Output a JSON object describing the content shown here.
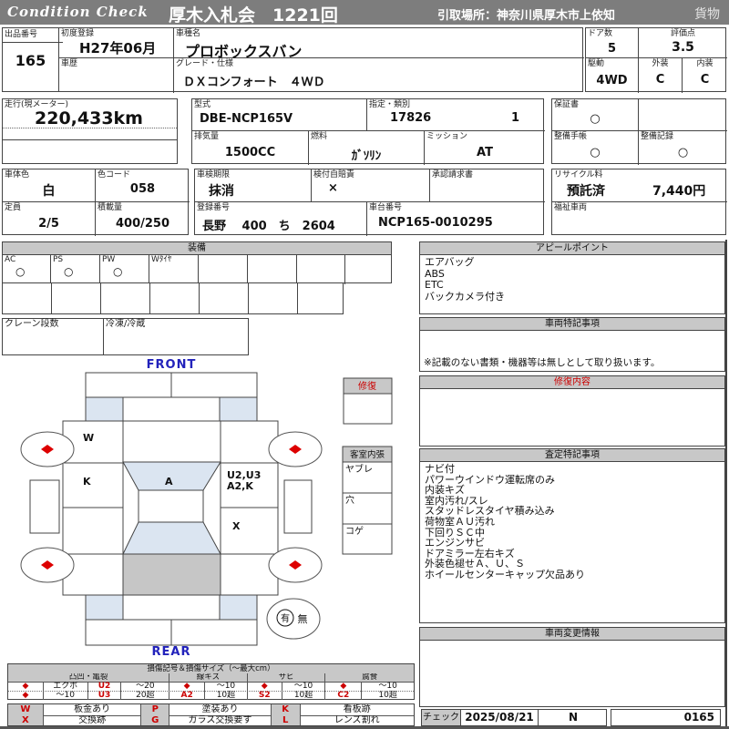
{
  "header": {
    "brand": "Condition  Check",
    "auction": "厚木入札会　1221回",
    "pickup": "引取場所：神奈川県厚木市上依知",
    "category": "貨物"
  },
  "info": {
    "exhibit_no_label": "出品番号",
    "exhibit_no": "165",
    "first_reg_label": "初度登録",
    "first_reg": "H27年06月",
    "history_label": "車歴",
    "history": "",
    "model_name_label": "車種名",
    "model_name": "プロボックスバン",
    "grade_label": "グレード・仕様",
    "grade": "ＤＸコンフォート　４ＷＤ",
    "doors_label": "ドア数",
    "doors": "5",
    "score_label": "評価点",
    "score": "3.5",
    "drive_label": "駆動",
    "drive": "4WD",
    "exterior_label": "外装",
    "exterior": "C",
    "interior_label": "内装",
    "interior": "C",
    "mileage_label": "走行(現メーター)",
    "mileage": "220,433km",
    "model_code_label": "型式",
    "model_code": "DBE-NCP165V",
    "class_label": "指定・類別",
    "class_no": "17826",
    "class_no2": "1",
    "warranty_label": "保証書",
    "warranty": "○",
    "displacement_label": "排気量",
    "displacement": "1500CC",
    "fuel_label": "燃料",
    "fuel": "ｶﾞｿﾘﾝ",
    "mission_label": "ミッション",
    "mission": "AT",
    "maintenance_book_label": "整備手帳",
    "maintenance_book": "○",
    "maintenance_record_label": "整備記録",
    "maintenance_record": "○",
    "body_color_label": "車体色",
    "body_color": "白",
    "color_code_label": "色コード",
    "color_code": "058",
    "inspection_label": "車検期限",
    "inspection": "抹消",
    "insurance_label": "検付自賠責",
    "insurance": "×",
    "approval_label": "承認請求書",
    "approval": "",
    "recycle_label": "リサイクル料",
    "recycle_status": "預託済",
    "recycle_fee": "7,440円",
    "capacity_label": "定員",
    "capacity": "2/5",
    "load_label": "積載量",
    "load": "400/250",
    "reg_no_label": "登録番号",
    "reg_no": "長野　 400　ち　2604",
    "chassis_label": "車台番号",
    "chassis_no": "NCP165-0010295",
    "welfare_label": "福祉車両",
    "welfare": ""
  },
  "equipment": {
    "title": "装備",
    "items": [
      {
        "label": "AC",
        "value": "○"
      },
      {
        "label": "PS",
        "value": "○"
      },
      {
        "label": "PW",
        "value": "○"
      },
      {
        "label": "Wﾀｲﾔ",
        "value": ""
      },
      {
        "label": "",
        "value": ""
      },
      {
        "label": "",
        "value": ""
      },
      {
        "label": "",
        "value": ""
      },
      {
        "label": "",
        "value": ""
      }
    ],
    "crane_label": "クレーン段数",
    "crane": "",
    "fridge_label": "冷凍/冷蔵",
    "fridge": ""
  },
  "diagram": {
    "front_label": "FRONT",
    "rear_label": "REAR",
    "marks": {
      "left_fender": "W",
      "left_door": "K",
      "windshield": "A",
      "right_door_1": "U2,U3",
      "right_door_2": "A2,K",
      "right_rear": "X"
    },
    "spare": {
      "yes": "有",
      "no": "無"
    },
    "repair_box_label": "修復",
    "interior_box": {
      "title": "客室内張",
      "rows": [
        "ヤブレ",
        "穴",
        "コゲ"
      ]
    }
  },
  "appeal": {
    "title": "アピールポイント",
    "items": [
      "エアバッグ",
      "ABS",
      "ETC",
      "バックカメラ付き"
    ]
  },
  "notes": {
    "title": "車両特記事項",
    "footnote": "※記載のない書類・機器等は無しとして取り扱います。"
  },
  "repair": {
    "title": "修復内容",
    "content": ""
  },
  "assessment": {
    "title": "査定特記事項",
    "items": [
      "ナビ付",
      "パワーウインドウ運転席のみ",
      "内装キズ",
      "室内汚れ/スレ",
      "スタッドレスタイヤ積み込み",
      "荷物室ＡＵ汚れ",
      "下回りＳＣ中",
      "エンジンサビ",
      "ドアミラー左右キズ",
      "外装色褪せＡ、Ｕ、Ｓ",
      "ホイールセンターキャップ欠品あり"
    ]
  },
  "change_info": {
    "title": "車両変更情報",
    "content": ""
  },
  "check": {
    "label": "チェック",
    "date": "2025/08/21",
    "code": "N",
    "number": "0165"
  },
  "legend": {
    "title": "損傷記号＆損傷サイズ（～最大cm）",
    "groups": [
      "凸凹・亀裂",
      "線キズ",
      "サビ",
      "腐食"
    ],
    "row1": [
      "◆",
      "エクボ",
      "U2",
      "～20",
      "◆",
      "～10",
      "◆",
      "～10",
      "◆",
      "～10"
    ],
    "row2": [
      "◆",
      "～10",
      "U3",
      "20超",
      "A2",
      "10超",
      "S2",
      "10超",
      "C2",
      "10超"
    ],
    "codes": [
      {
        "code": "W",
        "desc": "板金あり"
      },
      {
        "code": "P",
        "desc": "塗装あり"
      },
      {
        "code": "K",
        "desc": "看板跡"
      },
      {
        "code": "X",
        "desc": "交換跡"
      },
      {
        "code": "G",
        "desc": "ガラス交換要す"
      },
      {
        "code": "L",
        "desc": "レンズ割れ"
      }
    ]
  },
  "colors": {
    "accent_red": "#cc0000",
    "label_blue": "#2222bb",
    "shade_blue": "#dbe5f1",
    "shade_gray": "#c6c6c6",
    "bar_gray": "#7d7d7d"
  }
}
